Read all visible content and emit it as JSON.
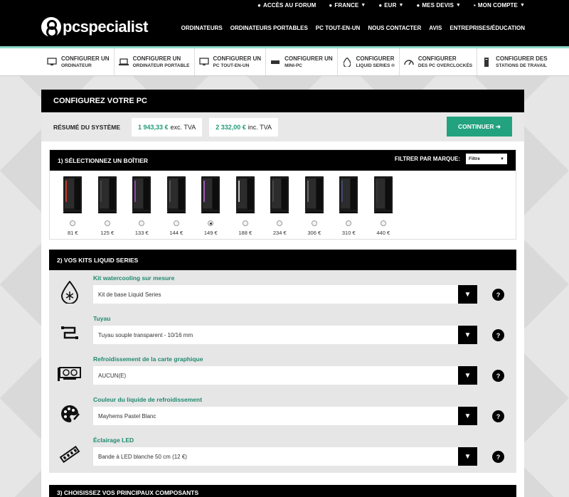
{
  "utilbar": {
    "forum": "ACCÈS AU FORUM",
    "country": "FRANCE",
    "currency": "EUR",
    "quotes": "MES DEVIS",
    "account": "MON COMPTE"
  },
  "header": {
    "logo_text": "pcspecialist",
    "nav": [
      "ORDINATEURS",
      "ORDINATEURS PORTABLES",
      "PC TOUT-EN-UN",
      "NOUS CONTACTER",
      "AVIS",
      "ENTREPRISES/ÉDUCATION"
    ]
  },
  "confnav": [
    {
      "l1": "CONFIGURER UN",
      "l2": "ORDINATEUR",
      "icon": "desktop-icon"
    },
    {
      "l1": "CONFIGURER UN",
      "l2": "ORDINATEUR PORTABLE",
      "icon": "laptop-icon"
    },
    {
      "l1": "CONFIGURER UN",
      "l2": "PC TOUT-EN-UN",
      "icon": "all-in-one-icon"
    },
    {
      "l1": "CONFIGURER UN",
      "l2": "MINI-PC",
      "icon": "mini-pc-icon"
    },
    {
      "l1": "CONFIGURER",
      "l2": "LIQUID SERIES ®",
      "icon": "droplet-icon"
    },
    {
      "l1": "CONFIGURER",
      "l2": "DES PC OVERCLOCKÉS",
      "icon": "gauge-icon"
    },
    {
      "l1": "CONFIGURER DES",
      "l2": "STATIONS DE TRAVAIL",
      "icon": "workstation-icon"
    }
  ],
  "panel": {
    "title": "CONFIGUREZ VOTRE PC",
    "summary_label": "RÉSUMÉ DU SYSTÈME",
    "price_ex": "1 943,33 €",
    "price_ex_suffix": "exc. TVA",
    "price_inc": "2 332,00 €",
    "price_inc_suffix": "inc. TVA",
    "continue": "CONTINUER ➜"
  },
  "section1": {
    "title": "1) SÉLECTIONNEZ UN BOÎTIER",
    "filter_label": "FILTRER PAR MARQUE:",
    "filter_value": "Filtre",
    "cases": [
      {
        "price": "81 €",
        "selected": false,
        "accent": "#c0392b"
      },
      {
        "price": "125 €",
        "selected": false,
        "accent": "#444444"
      },
      {
        "price": "133 €",
        "selected": false,
        "accent": "#8e44ad"
      },
      {
        "price": "144 €",
        "selected": false,
        "accent": "#555555"
      },
      {
        "price": "149 €",
        "selected": true,
        "accent": "#9b59b6"
      },
      {
        "price": "188 €",
        "selected": false,
        "accent": "#bbbbbb"
      },
      {
        "price": "234 €",
        "selected": false,
        "accent": "#444444"
      },
      {
        "price": "306 €",
        "selected": false,
        "accent": "#666666"
      },
      {
        "price": "310 €",
        "selected": false,
        "accent": "#3d4a6b"
      },
      {
        "price": "440 €",
        "selected": false,
        "accent": "#333333"
      }
    ]
  },
  "section2": {
    "title": "2) VOS KITS LIQUID SERIES",
    "options": [
      {
        "label": "Kit watercooling sur mesure",
        "value": "Kit de base Liquid Series",
        "icon": "droplet-snowflake-icon"
      },
      {
        "label": "Tuyau",
        "value": "Tuyau souple transparent - 10/16 mm",
        "icon": "tube-icon"
      },
      {
        "label": "Refroidissement de la carte graphique",
        "value": "AUCUN(E)",
        "icon": "graphics-card-icon"
      },
      {
        "label": "Couleur du liquide de refroidissement",
        "value": "Mayhems Pastel Blanc",
        "icon": "palette-icon"
      },
      {
        "label": "Éclairage LED",
        "value": "Bande à LED blanche 50 cm (12 €)",
        "icon": "led-strip-icon"
      }
    ]
  },
  "section3": {
    "title": "3) CHOISISSEZ VOS PRINCIPAUX COMPOSANTS"
  }
}
